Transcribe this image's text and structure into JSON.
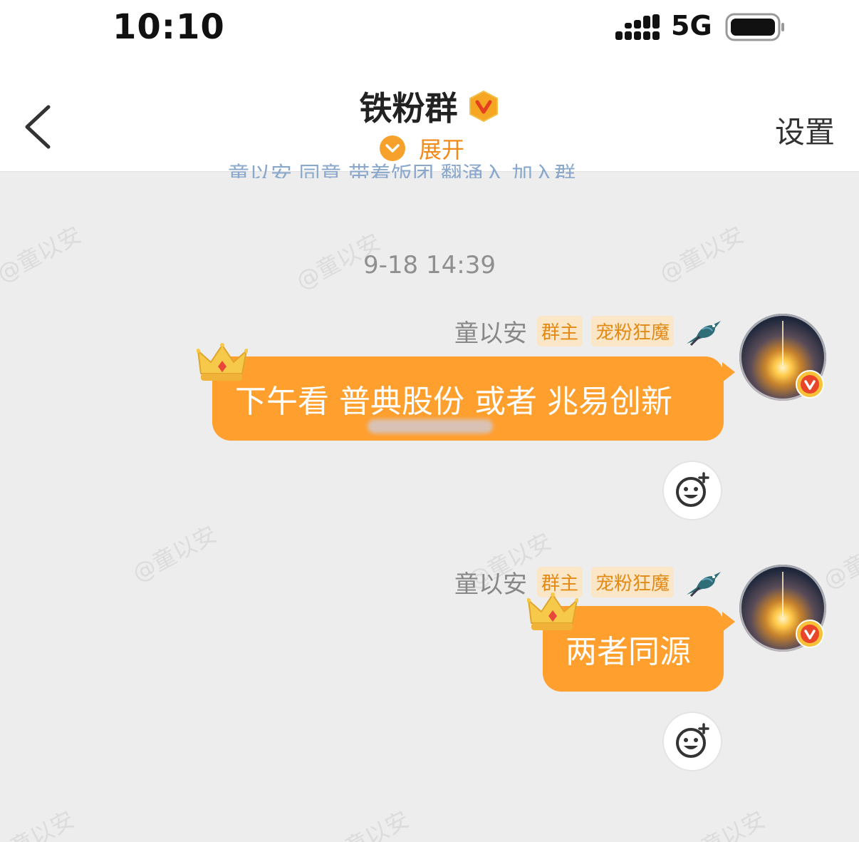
{
  "status_bar": {
    "time": "10:10",
    "network": "5G"
  },
  "header": {
    "title": "铁粉群",
    "expand_label": "展开",
    "settings_label": "设置"
  },
  "chat": {
    "notice_fragment": "童以安 同意 带着饭团 翻涌入 加入群",
    "timestamp": "9-18 14:39",
    "watermark": "@童以安",
    "messages": [
      {
        "sender": "童以安",
        "role_tag": "群主",
        "fan_tag": "宠粉狂魔",
        "text": "下午看 普典股份 或者 兆易创新"
      },
      {
        "sender": "童以安",
        "role_tag": "群主",
        "fan_tag": "宠粉狂魔",
        "text": "两者同源"
      }
    ]
  },
  "colors": {
    "bubble": "#ff9f2e",
    "accent": "#f28a1a",
    "tag_bg": "#fbe6c7"
  },
  "icons": [
    "back-arrow-icon",
    "vip-badge-icon",
    "expand-chevron-icon",
    "bird-icon",
    "crown-icon",
    "verified-v-icon",
    "add-reaction-icon",
    "signal-icon",
    "battery-icon"
  ]
}
